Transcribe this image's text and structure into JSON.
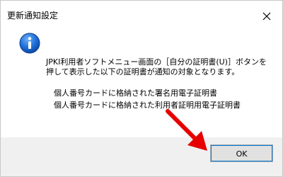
{
  "dialog": {
    "title": "更新通知設定",
    "message": {
      "line1": "JPKI利用者ソフトメニュー画面の［自分の証明書(U)］ボタンを",
      "line2": "押して表示した以下の証明書が通知の対象となります。",
      "line3": "個人番号カードに格納された署名用電子証明書",
      "line4": "個人番号カードに格納された利用者証明用電子証明書"
    },
    "ok_label": "OK"
  },
  "colors": {
    "info_icon": "#1e6fd9",
    "annotation_arrow": "#e60000",
    "footer_bg": "#f0f0f0"
  },
  "icons": {
    "close": "close-icon",
    "info": "information-icon",
    "arrow": "red-arrow-annotation"
  }
}
